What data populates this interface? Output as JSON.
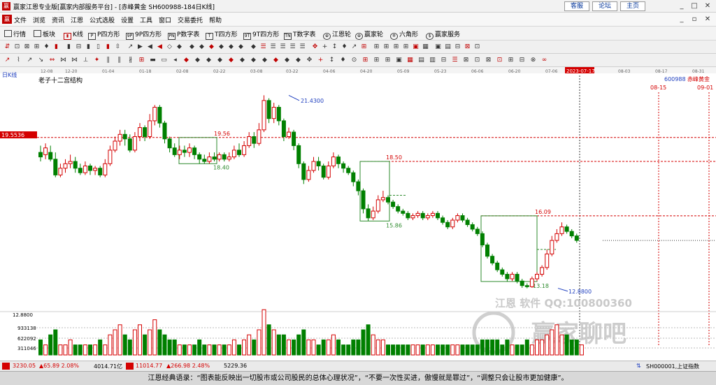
{
  "window": {
    "title": "赢家江恩专业版[赢家内部服务平台] - [赤峰黄金  SH600988-184日K线]",
    "buttons": [
      "客服",
      "论坛",
      "主页"
    ]
  },
  "menu": [
    "文件",
    "浏览",
    "资讯",
    "江恩",
    "公式选股",
    "设置",
    "工具",
    "窗口",
    "交易委托",
    "帮助"
  ],
  "nav": [
    {
      "icon": "grid-icon",
      "label": "行情"
    },
    {
      "icon": "grid-icon",
      "label": "板块"
    },
    {
      "icon": "kline-icon",
      "label": "K线"
    },
    {
      "icon": "p-square-icon",
      "label": "P四方形"
    },
    {
      "icon": "9p-square-icon",
      "label": "9P四方形"
    },
    {
      "icon": "pn-icon",
      "label": "P数字表"
    },
    {
      "icon": "t-square-icon",
      "label": "T四方形"
    },
    {
      "icon": "9t-square-icon",
      "label": "9T四方形"
    },
    {
      "icon": "tn-icon",
      "label": "T数字表"
    },
    {
      "icon": "wheel-icon",
      "label": "江恩轮"
    },
    {
      "icon": "wheel-icon",
      "label": "赢家轮"
    },
    {
      "icon": "hexagon-icon",
      "label": "六角形"
    },
    {
      "icon": "service-icon",
      "label": "赢家服务"
    }
  ],
  "chart_header": {
    "period_label": "日K线",
    "indicator_label": "老子十二宫结构",
    "stock_code": "600988",
    "stock_name": "赤峰黄金",
    "left_price_tag": "19.5536",
    "date_marker": "2023-07-17",
    "future_dates": [
      "08-15",
      "09-01"
    ]
  },
  "time_axis_labels": [
    "12-08",
    "12-20",
    "01-04",
    "01-18",
    "02-08",
    "02-22",
    "03-08",
    "03-22",
    "04-06",
    "04-20",
    "05-09",
    "05-23",
    "06-06",
    "06-20",
    "07-06",
    "2023-07-17",
    "08-03",
    "08-17",
    "08-31"
  ],
  "chart_data": {
    "type": "candlestick",
    "title": "老子十二宫结构",
    "ylim": [
      12.0,
      22.0
    ],
    "price_annotations": [
      "21.4300",
      "19.56",
      "18.40",
      "18.50",
      "15.86",
      "16.09",
      "13.18",
      "12.8800"
    ],
    "volume_axis": [
      "12.8800",
      "933138",
      "622092",
      "311046"
    ],
    "watermark": [
      "江恩      软件  QQ:100800360",
      "赢家聊吧"
    ],
    "candles": [
      {
        "o": 18.9,
        "c": 18.7,
        "h": 19.2,
        "l": 18.5
      },
      {
        "o": 18.8,
        "c": 19.1,
        "h": 19.3,
        "l": 18.6
      },
      {
        "o": 18.9,
        "c": 18.6,
        "h": 19.2,
        "l": 18.5
      },
      {
        "o": 18.6,
        "c": 17.9,
        "h": 18.9,
        "l": 17.8
      },
      {
        "o": 17.9,
        "c": 18.2,
        "h": 18.4,
        "l": 17.8
      },
      {
        "o": 18.2,
        "c": 18.4,
        "h": 18.6,
        "l": 18.0
      },
      {
        "o": 18.4,
        "c": 18.5,
        "h": 18.8,
        "l": 18.2
      },
      {
        "o": 18.5,
        "c": 18.2,
        "h": 18.7,
        "l": 18.0
      },
      {
        "o": 18.2,
        "c": 18.0,
        "h": 18.4,
        "l": 17.9
      },
      {
        "o": 18.0,
        "c": 18.3,
        "h": 18.5,
        "l": 17.9
      },
      {
        "o": 18.3,
        "c": 18.1,
        "h": 18.4,
        "l": 17.9
      },
      {
        "o": 18.1,
        "c": 18.2,
        "h": 18.3,
        "l": 17.9
      },
      {
        "o": 18.2,
        "c": 17.9,
        "h": 18.3,
        "l": 17.8
      },
      {
        "o": 17.9,
        "c": 18.4,
        "h": 18.6,
        "l": 17.8
      },
      {
        "o": 18.4,
        "c": 19.0,
        "h": 19.2,
        "l": 18.3
      },
      {
        "o": 19.0,
        "c": 19.4,
        "h": 19.6,
        "l": 18.9
      },
      {
        "o": 19.4,
        "c": 19.7,
        "h": 19.9,
        "l": 19.2
      },
      {
        "o": 19.7,
        "c": 19.5,
        "h": 19.9,
        "l": 19.2
      },
      {
        "o": 19.5,
        "c": 19.0,
        "h": 19.7,
        "l": 18.9
      },
      {
        "o": 19.0,
        "c": 19.6,
        "h": 19.8,
        "l": 18.9
      },
      {
        "o": 19.6,
        "c": 20.0,
        "h": 20.2,
        "l": 19.4
      },
      {
        "o": 20.0,
        "c": 19.6,
        "h": 20.1,
        "l": 19.4
      },
      {
        "o": 19.6,
        "c": 20.3,
        "h": 20.6,
        "l": 19.5
      },
      {
        "o": 20.3,
        "c": 20.9,
        "h": 21.0,
        "l": 20.1
      },
      {
        "o": 20.9,
        "c": 20.2,
        "h": 21.0,
        "l": 20.0
      },
      {
        "o": 20.2,
        "c": 19.5,
        "h": 20.3,
        "l": 19.3
      },
      {
        "o": 19.5,
        "c": 19.1,
        "h": 19.6,
        "l": 18.9
      },
      {
        "o": 19.1,
        "c": 18.8,
        "h": 19.3,
        "l": 18.7
      },
      {
        "o": 18.8,
        "c": 19.0,
        "h": 19.2,
        "l": 18.6
      },
      {
        "o": 19.0,
        "c": 18.9,
        "h": 19.2,
        "l": 18.7
      },
      {
        "o": 18.9,
        "c": 19.1,
        "h": 19.3,
        "l": 18.7
      },
      {
        "o": 19.1,
        "c": 18.8,
        "h": 19.2,
        "l": 18.6
      },
      {
        "o": 18.8,
        "c": 18.6,
        "h": 18.9,
        "l": 18.4
      },
      {
        "o": 18.6,
        "c": 18.5,
        "h": 18.8,
        "l": 18.4
      },
      {
        "o": 18.5,
        "c": 18.7,
        "h": 18.9,
        "l": 18.4
      },
      {
        "o": 18.7,
        "c": 18.6,
        "h": 18.9,
        "l": 18.5
      },
      {
        "o": 18.6,
        "c": 18.8,
        "h": 18.9,
        "l": 18.5
      },
      {
        "o": 18.8,
        "c": 18.6,
        "h": 18.9,
        "l": 18.5
      },
      {
        "o": 18.6,
        "c": 18.7,
        "h": 18.9,
        "l": 18.5
      },
      {
        "o": 18.7,
        "c": 19.0,
        "h": 19.2,
        "l": 18.6
      },
      {
        "o": 19.0,
        "c": 18.8,
        "h": 19.3,
        "l": 18.7
      },
      {
        "o": 18.8,
        "c": 19.2,
        "h": 19.4,
        "l": 18.7
      },
      {
        "o": 19.2,
        "c": 19.6,
        "h": 19.8,
        "l": 19.1
      },
      {
        "o": 19.6,
        "c": 19.3,
        "h": 19.8,
        "l": 19.1
      },
      {
        "o": 19.3,
        "c": 19.9,
        "h": 20.2,
        "l": 19.2
      },
      {
        "o": 19.9,
        "c": 21.2,
        "h": 21.43,
        "l": 19.8
      },
      {
        "o": 21.2,
        "c": 20.4,
        "h": 21.3,
        "l": 20.2
      },
      {
        "o": 20.4,
        "c": 20.9,
        "h": 21.1,
        "l": 20.2
      },
      {
        "o": 20.9,
        "c": 20.3,
        "h": 21.0,
        "l": 20.1
      },
      {
        "o": 20.3,
        "c": 19.6,
        "h": 20.4,
        "l": 19.4
      },
      {
        "o": 19.6,
        "c": 19.8,
        "h": 20.0,
        "l": 19.5
      },
      {
        "o": 19.8,
        "c": 19.2,
        "h": 19.9,
        "l": 19.0
      },
      {
        "o": 19.2,
        "c": 18.4,
        "h": 19.3,
        "l": 18.2
      },
      {
        "o": 18.4,
        "c": 17.7,
        "h": 18.5,
        "l": 17.5
      },
      {
        "o": 17.7,
        "c": 18.1,
        "h": 18.3,
        "l": 17.6
      },
      {
        "o": 18.1,
        "c": 18.5,
        "h": 18.7,
        "l": 18.0
      },
      {
        "o": 18.5,
        "c": 18.3,
        "h": 18.7,
        "l": 18.1
      },
      {
        "o": 18.3,
        "c": 17.8,
        "h": 18.4,
        "l": 17.7
      },
      {
        "o": 17.8,
        "c": 18.3,
        "h": 18.5,
        "l": 17.7
      },
      {
        "o": 18.3,
        "c": 18.7,
        "h": 18.9,
        "l": 18.2
      },
      {
        "o": 18.7,
        "c": 18.4,
        "h": 18.8,
        "l": 18.2
      },
      {
        "o": 18.4,
        "c": 18.2,
        "h": 18.5,
        "l": 18.0
      },
      {
        "o": 18.2,
        "c": 18.0,
        "h": 18.3,
        "l": 17.9
      },
      {
        "o": 18.0,
        "c": 17.6,
        "h": 18.1,
        "l": 17.4
      },
      {
        "o": 17.6,
        "c": 17.2,
        "h": 17.7,
        "l": 17.0
      },
      {
        "o": 17.2,
        "c": 16.4,
        "h": 17.3,
        "l": 16.2
      },
      {
        "o": 16.4,
        "c": 16.0,
        "h": 16.6,
        "l": 15.86
      },
      {
        "o": 16.0,
        "c": 16.3,
        "h": 16.5,
        "l": 15.9
      },
      {
        "o": 16.3,
        "c": 16.8,
        "h": 17.0,
        "l": 16.2
      },
      {
        "o": 16.8,
        "c": 16.9,
        "h": 17.2,
        "l": 16.7
      },
      {
        "o": 16.9,
        "c": 16.7,
        "h": 17.0,
        "l": 16.6
      },
      {
        "o": 16.7,
        "c": 16.5,
        "h": 16.8,
        "l": 16.4
      },
      {
        "o": 16.5,
        "c": 16.3,
        "h": 16.6,
        "l": 16.2
      },
      {
        "o": 16.3,
        "c": 16.2,
        "h": 16.4,
        "l": 16.1
      },
      {
        "o": 16.2,
        "c": 16.0,
        "h": 16.3,
        "l": 15.9
      },
      {
        "o": 16.0,
        "c": 16.1,
        "h": 16.2,
        "l": 15.9
      },
      {
        "o": 16.1,
        "c": 16.2,
        "h": 16.3,
        "l": 16.0
      },
      {
        "o": 16.2,
        "c": 16.0,
        "h": 16.3,
        "l": 15.9
      },
      {
        "o": 16.0,
        "c": 16.1,
        "h": 16.2,
        "l": 15.9
      },
      {
        "o": 16.1,
        "c": 16.2,
        "h": 16.3,
        "l": 16.0
      },
      {
        "o": 16.2,
        "c": 16.0,
        "h": 16.3,
        "l": 15.9
      },
      {
        "o": 16.0,
        "c": 15.8,
        "h": 16.1,
        "l": 15.7
      },
      {
        "o": 15.8,
        "c": 15.6,
        "h": 15.9,
        "l": 15.5
      },
      {
        "o": 15.6,
        "c": 15.9,
        "h": 16.0,
        "l": 15.5
      },
      {
        "o": 15.9,
        "c": 16.1,
        "h": 16.2,
        "l": 15.8
      },
      {
        "o": 16.1,
        "c": 15.9,
        "h": 16.2,
        "l": 15.8
      },
      {
        "o": 15.9,
        "c": 15.7,
        "h": 16.0,
        "l": 15.6
      },
      {
        "o": 15.7,
        "c": 15.5,
        "h": 15.8,
        "l": 15.4
      },
      {
        "o": 15.5,
        "c": 15.3,
        "h": 15.6,
        "l": 15.2
      },
      {
        "o": 15.3,
        "c": 14.8,
        "h": 15.4,
        "l": 14.7
      },
      {
        "o": 14.8,
        "c": 14.3,
        "h": 14.9,
        "l": 14.2
      },
      {
        "o": 14.3,
        "c": 14.0,
        "h": 14.4,
        "l": 13.9
      },
      {
        "o": 14.0,
        "c": 13.7,
        "h": 14.1,
        "l": 13.6
      },
      {
        "o": 13.7,
        "c": 13.5,
        "h": 13.8,
        "l": 13.4
      },
      {
        "o": 13.5,
        "c": 13.3,
        "h": 13.6,
        "l": 13.18
      },
      {
        "o": 13.3,
        "c": 13.5,
        "h": 13.6,
        "l": 13.2
      },
      {
        "o": 13.5,
        "c": 13.2,
        "h": 13.6,
        "l": 13.1
      },
      {
        "o": 13.2,
        "c": 13.0,
        "h": 13.3,
        "l": 12.9
      },
      {
        "o": 13.0,
        "c": 12.95,
        "h": 13.1,
        "l": 12.88
      },
      {
        "o": 12.95,
        "c": 13.3,
        "h": 13.4,
        "l": 12.9
      },
      {
        "o": 13.3,
        "c": 13.5,
        "h": 13.6,
        "l": 13.2
      },
      {
        "o": 13.5,
        "c": 13.8,
        "h": 13.9,
        "l": 13.4
      },
      {
        "o": 13.8,
        "c": 14.4,
        "h": 14.6,
        "l": 13.7
      },
      {
        "o": 14.4,
        "c": 15.0,
        "h": 15.2,
        "l": 14.3
      },
      {
        "o": 15.0,
        "c": 15.3,
        "h": 15.5,
        "l": 14.9
      },
      {
        "o": 15.3,
        "c": 15.6,
        "h": 15.8,
        "l": 15.2
      },
      {
        "o": 15.6,
        "c": 15.4,
        "h": 15.7,
        "l": 15.3
      },
      {
        "o": 15.4,
        "c": 15.2,
        "h": 15.5,
        "l": 15.1
      },
      {
        "o": 15.2,
        "c": 15.0,
        "h": 15.3,
        "l": 14.9
      }
    ],
    "volumes": [
      3,
      2,
      4,
      5,
      2,
      2,
      3,
      2,
      2,
      2,
      2,
      2,
      3,
      2,
      4,
      5,
      6,
      4,
      3,
      5,
      6,
      4,
      5,
      7,
      5,
      4,
      3,
      3,
      2,
      2,
      2,
      2,
      3,
      2,
      2,
      2,
      2,
      2,
      2,
      3,
      2,
      3,
      4,
      3,
      5,
      9,
      6,
      5,
      4,
      4,
      3,
      3,
      4,
      5,
      3,
      3,
      2,
      3,
      3,
      4,
      3,
      2,
      2,
      3,
      3,
      5,
      6,
      4,
      3,
      3,
      2,
      2,
      2,
      2,
      2,
      2,
      2,
      2,
      2,
      2,
      2,
      2,
      2,
      2,
      2,
      2,
      2,
      2,
      2,
      3,
      3,
      3,
      3,
      2,
      3,
      2,
      2,
      2,
      3,
      2,
      3,
      3,
      4,
      5,
      6,
      4,
      4,
      3,
      3,
      2
    ]
  },
  "status": {
    "sh_index": "3230.05",
    "sh_change": "▲65.89 2.08%",
    "sh_amount": "4014.71亿",
    "sz_index": "11014.77",
    "sz_change": "▲266.98 2.48%",
    "sz_amount": "5229.36",
    "right_code": "SH000001,上证指数"
  },
  "quote": "江恩经典语录：“图表能反映出一切股市或公司股民的总体心理状况”，“不要一次性买进，傲慢就是罪过”，“调整只会让股市更加健康”。",
  "colors": {
    "up": "#d40000",
    "down": "#008000",
    "red_dash": "#d40000",
    "box_green": "#2e8b2e",
    "blue_label": "#1f3fbf"
  }
}
